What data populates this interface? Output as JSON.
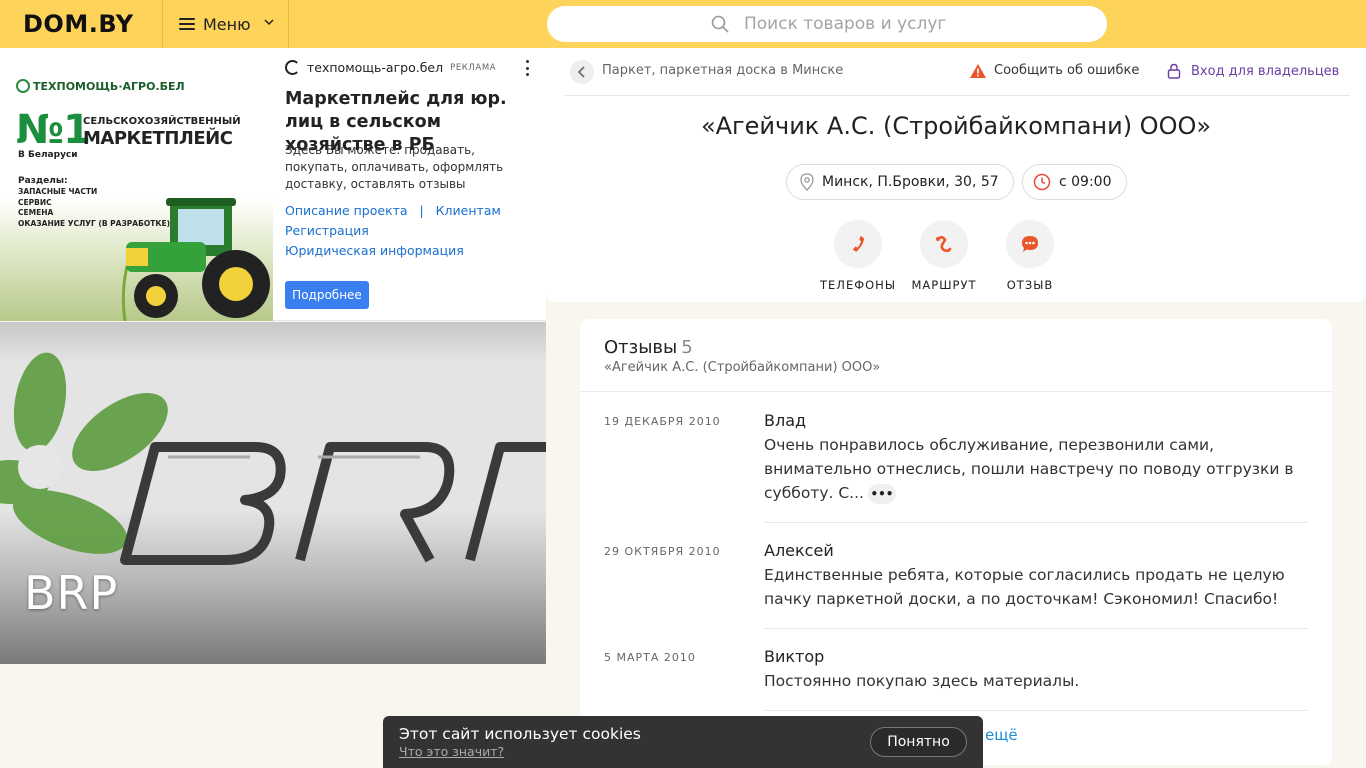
{
  "header": {
    "logo": "DOM.BY",
    "menu_label": "Меню",
    "search_placeholder": "Поиск товаров и услуг"
  },
  "ad": {
    "image": {
      "brand": "ТЕХПОМОЩЬ·АГРО.БЕЛ",
      "n1": "№1",
      "line1": "СЕЛЬСКОХОЗЯЙСТВЕННЫЙ",
      "line2": "МАРКЕТПЛЕЙС",
      "line3": "В Беларуси",
      "sections_title": "Разделы:",
      "sections": [
        "ЗАПАСНЫЕ ЧАСТИ",
        "СЕРВИС",
        "СЕМЕНА",
        "ОКАЗАНИЕ УСЛУГ (В РАЗРАБОТКЕ)"
      ]
    },
    "source": "техпомощь-агро.бел",
    "tag": "РЕКЛАМА",
    "title": "Маркетплейс для юр. лиц в сельском хозяйстве в РБ",
    "description": "Здесь Вы можете: продавать, покупать, оплачивать, оформлять доставку, оставлять отзывы",
    "links": {
      "project": "Описание проекта",
      "separator": "|",
      "clients": "Клиентам",
      "registration": "Регистрация",
      "legal": "Юридическая информация"
    },
    "button": "Подробнее"
  },
  "brp": {
    "title": "BRP"
  },
  "company": {
    "breadcrumb": "Паркет, паркетная доска в Минске",
    "report_error": "Сообщить об ошибке",
    "owner_login": "Вход для владельцев",
    "name": "«Агейчик А.С. (Стройбайкомпани) ООО»",
    "address": "Минск, П.Бровки, 30, 57",
    "hours": "с 09:00",
    "actions": {
      "phones": "ТЕЛЕФОНЫ",
      "route": "МАРШРУТ",
      "review": "ОТЗЫВ"
    }
  },
  "reviews": {
    "title": "Отзывы",
    "count": "5",
    "subtitle": "«Агейчик А.С. (Стройбайкомпани) ООО»",
    "items": [
      {
        "date": "19 ДЕКАБРЯ 2010",
        "author": "Влад",
        "text": "Очень понравилось обслуживание, перезвонили сами, внимательно отнеслись, пошли навстречу по поводу отгрузки в субботу. С..."
      },
      {
        "date": "29 ОКТЯБРЯ 2010",
        "author": "Алексей",
        "text": "Единственные ребята, которые согласились продать не целую пачку паркетной доски, а по досточкам! Сэкономил! Спасибо!"
      },
      {
        "date": "5 МАРТА 2010",
        "author": "Виктор",
        "text": "Постоянно покупаю здесь материалы."
      }
    ],
    "show_more": "ещё",
    "expand_glyph": "•••"
  },
  "cookie": {
    "text": "Этот сайт использует cookies",
    "link": "Что это значит?",
    "button": "Понятно"
  },
  "colors": {
    "header_bg": "#fdd35a",
    "accent_orange": "#e8562a",
    "link_blue": "#1a6fcf",
    "owner_purple": "#6b3fa0"
  }
}
